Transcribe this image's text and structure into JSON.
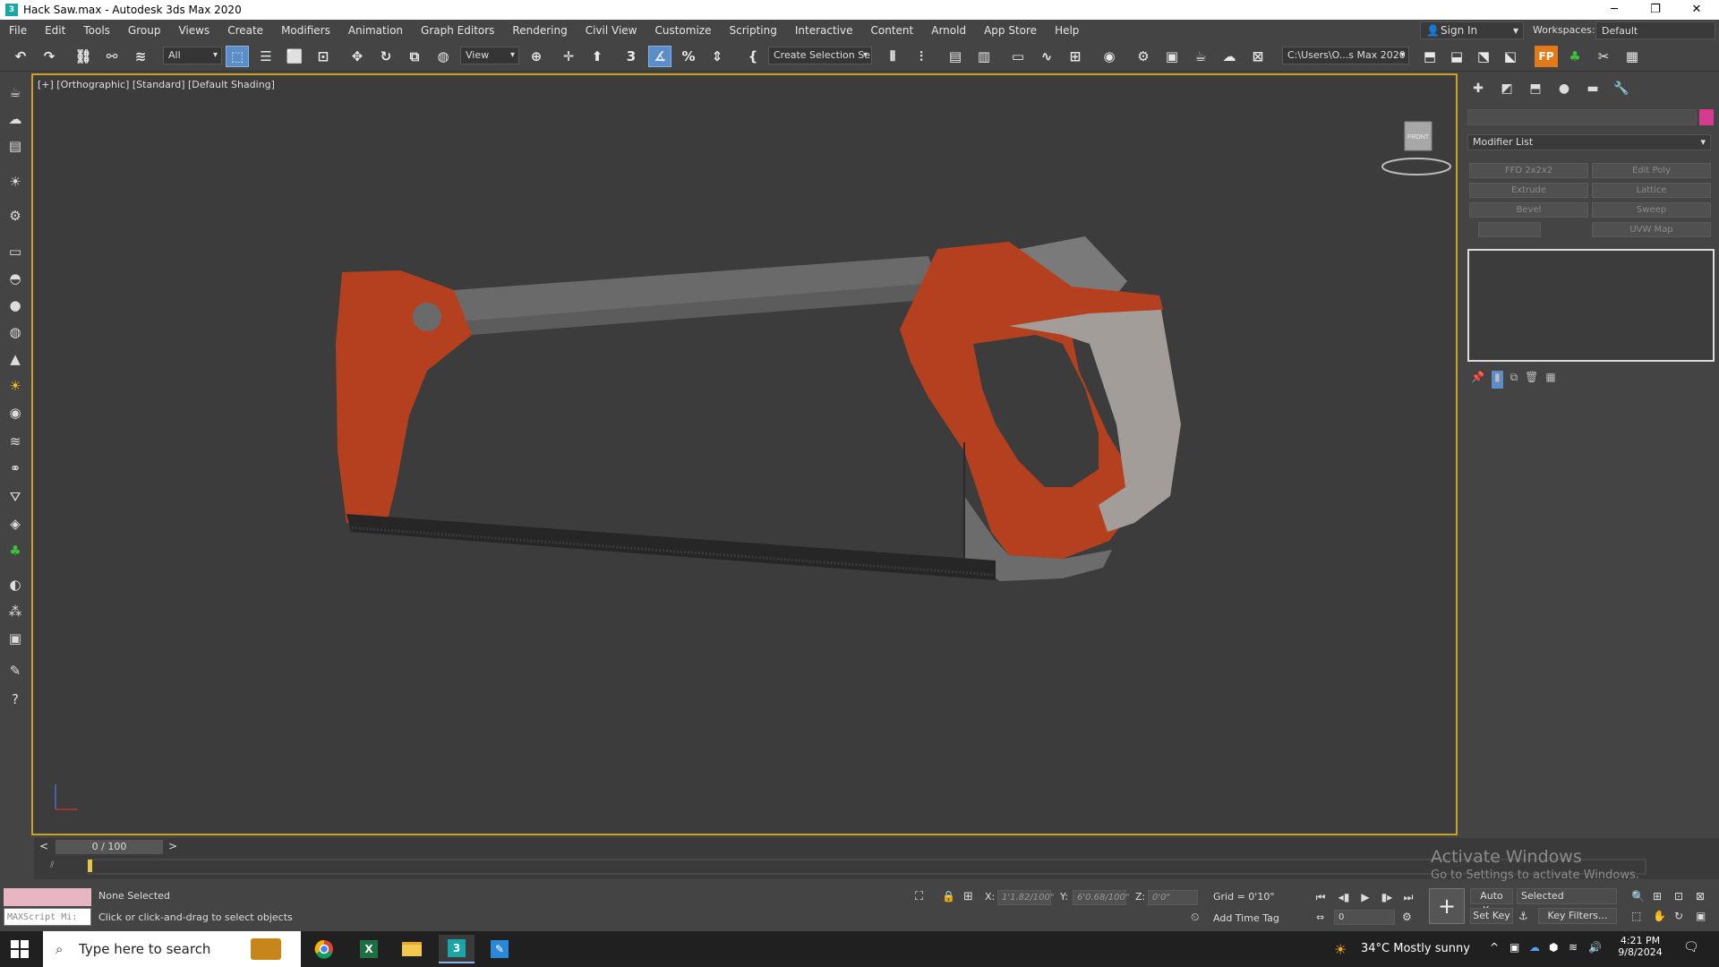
{
  "window": {
    "title": "Hack Saw.max - Autodesk 3ds Max 2020",
    "minimize": "─",
    "restore": "❐",
    "close": "✕"
  },
  "menu": [
    "File",
    "Edit",
    "Tools",
    "Group",
    "Views",
    "Create",
    "Modifiers",
    "Animation",
    "Graph Editors",
    "Rendering",
    "Civil View",
    "Customize",
    "Scripting",
    "Interactive",
    "Content",
    "Arnold",
    "App Store",
    "Help"
  ],
  "account": {
    "sign_in": "Sign In",
    "workspaces_label": "Workspaces:",
    "workspace": "Default"
  },
  "toolbar": {
    "filter": "All",
    "ref_coord": "View",
    "selection_set": "Create Selection Se",
    "project_path": "C:\\Users\\O...s Max 2020"
  },
  "viewport": {
    "label": "[+] [Orthographic] [Standard] [Default Shading]",
    "viewcube_face": "FRONT",
    "object_colors": {
      "handle": "#b5401f",
      "grip": "#a39d9a",
      "frame": "#6a6a6a",
      "blade": "#262626"
    }
  },
  "command_panel": {
    "modifier_list": "Modifier List",
    "buttons": [
      "FFD 2x2x2",
      "Edit Poly",
      "Extrude",
      "Lattice",
      "Bevel",
      "Sweep",
      "",
      "UVW Map"
    ],
    "object_color": "#d43c8f"
  },
  "timeline": {
    "slider": "0 / 100",
    "prev": "<",
    "next": ">"
  },
  "status": {
    "selection": "None Selected",
    "prompt": "Click or click-and-drag to select objects",
    "maxscript": "MAXScript Mi:",
    "x_label": "X:",
    "x_value": "1'1.82/100\"",
    "y_label": "Y:",
    "y_value": "6'0.68/100\"",
    "z_label": "Z:",
    "z_value": "0'0\"",
    "grid": "Grid = 0'10\"",
    "add_time_tag": "Add Time Tag",
    "auto_key": "Auto Key",
    "set_key": "Set Key",
    "key_mode": "Selected",
    "key_filters": "Key Filters...",
    "frame": "0"
  },
  "activation": {
    "line1": "Activate Windows",
    "line2": "Go to Settings to activate Windows."
  },
  "taskbar": {
    "search": "Type here to search",
    "weather": "34°C  Mostly sunny",
    "time": "4:21 PM",
    "date": "9/8/2024"
  }
}
